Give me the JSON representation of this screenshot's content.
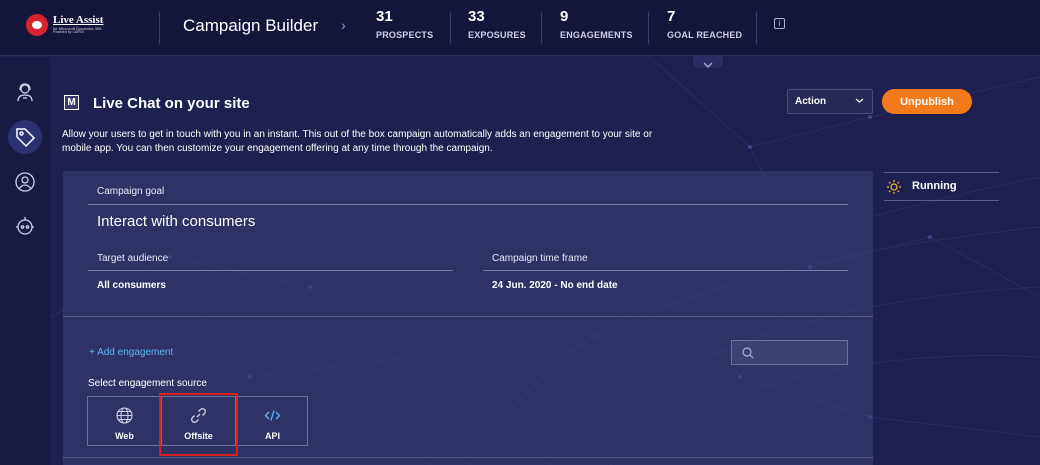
{
  "brand": {
    "name": "Live Assist",
    "subtitle": "for Microsoft Dynamics 365",
    "powered": "Powered by CAFEX"
  },
  "header": {
    "title": "Campaign Builder",
    "stats": [
      {
        "value": "31",
        "label": "PROSPECTS"
      },
      {
        "value": "33",
        "label": "EXPOSURES"
      },
      {
        "value": "9",
        "label": "ENGAGEMENTS"
      },
      {
        "value": "7",
        "label": "GOAL REACHED"
      }
    ],
    "info_icon": "i"
  },
  "sidebar": {
    "items": [
      {
        "icon": "agent-icon"
      },
      {
        "icon": "tag-icon",
        "active": true
      },
      {
        "icon": "user-circle-icon"
      },
      {
        "icon": "bot-icon"
      }
    ]
  },
  "campaign": {
    "badge": "M",
    "title": "Live Chat on your site",
    "description": "Allow your users to get in touch with you in an instant. This out of the box campaign automatically adds an engagement to your site or mobile app. You can then customize your engagement offering at any time through the campaign.",
    "action_label": "Action",
    "unpublish_label": "Unpublish",
    "status": "Running",
    "goal_label": "Campaign goal",
    "goal_value": "Interact with consumers",
    "audience_label": "Target audience",
    "audience_value": "All consumers",
    "timeframe_label": "Campaign time frame",
    "timeframe_value": "24 Jun. 2020 - No end date",
    "add_engagement": "+  Add engagement",
    "source_label": "Select engagement source",
    "sources": [
      {
        "label": "Web",
        "icon": "globe-icon"
      },
      {
        "label": "Offsite",
        "icon": "link-icon"
      },
      {
        "label": "API",
        "icon": "code-icon"
      }
    ]
  },
  "colors": {
    "accent": "#f27a1a",
    "link": "#5db8f4",
    "highlight": "#d81f1f",
    "background": "#1e2050"
  }
}
